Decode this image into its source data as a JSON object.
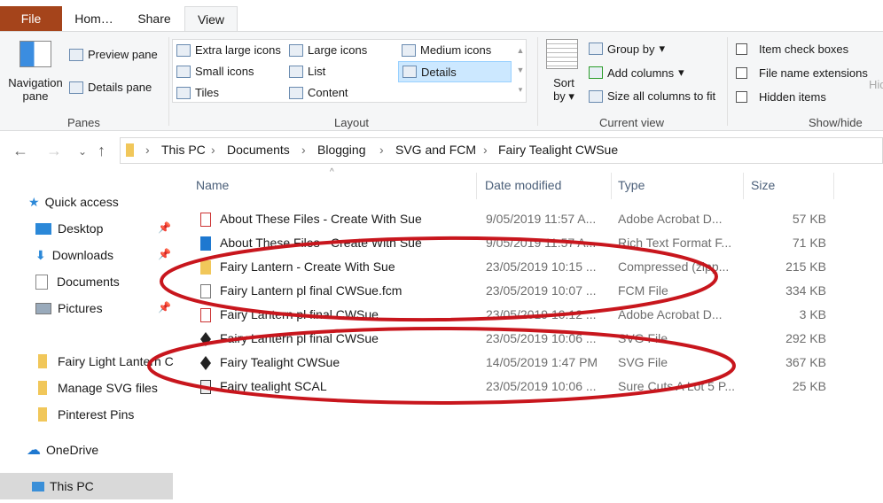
{
  "ribbon_tabs": [
    "File",
    "Hom…",
    "Share",
    "View"
  ],
  "panes": {
    "navigation_pane": "Navigation",
    "navigation_pane2": "pane",
    "preview_pane": "Preview pane",
    "details_pane": "Details pane",
    "label": "Panes"
  },
  "layout": {
    "items": [
      "Extra large icons",
      "Large icons",
      "Medium icons",
      "Small icons",
      "List",
      "Details",
      "Tiles",
      "Content"
    ],
    "selected": "Details",
    "label": "Layout"
  },
  "current_view": {
    "sort": "Sort",
    "sort2": "by",
    "group_by": "Group by",
    "add_columns": "Add columns",
    "size_columns": "Size all columns to fit",
    "label": "Current view"
  },
  "show_hide": {
    "item_check_boxes": "Item check boxes",
    "file_name_extensions": "File name extensions",
    "hidden_items": "Hidden items",
    "label": "Show/hide",
    "hide_cut": "Hid"
  },
  "breadcrumb": [
    "This PC",
    "Documents",
    "Blogging",
    "SVG and FCM",
    "Fairy Tealight CWSue"
  ],
  "sidebar": {
    "quick_access": "Quick access",
    "pinned": [
      "Desktop",
      "Downloads",
      "Documents",
      "Pictures"
    ],
    "folders": [
      "Fairy Light Lantern C",
      "Manage SVG files",
      "Pinterest Pins"
    ],
    "onedrive": "OneDrive",
    "this_pc": "This PC"
  },
  "columns": [
    "Name",
    "Date modified",
    "Type",
    "Size"
  ],
  "files": [
    {
      "name": "About These Files - Create With Sue",
      "date": "9/05/2019 11:57 A...",
      "type": "Adobe Acrobat D...",
      "size": "57 KB",
      "icon": "pdf-icon"
    },
    {
      "name": "About These Files - Create With Sue",
      "date": "9/05/2019 11:57 A...",
      "type": "Rich Text Format F...",
      "size": "71 KB",
      "icon": "rtf-icon"
    },
    {
      "name": "Fairy Lantern - Create With Sue",
      "date": "23/05/2019 10:15 ...",
      "type": "Compressed (zipp...",
      "size": "215 KB",
      "icon": "zip-icon"
    },
    {
      "name": "Fairy Lantern pl final CWSue.fcm",
      "date": "23/05/2019 10:07 ...",
      "type": "FCM File",
      "size": "334 KB",
      "icon": "file-icon"
    },
    {
      "name": "Fairy Lantern pl final CWSue",
      "date": "23/05/2019 10:12 ...",
      "type": "Adobe Acrobat D...",
      "size": "3 KB",
      "icon": "pdf-icon"
    },
    {
      "name": "Fairy Lantern pl final CWSue",
      "date": "23/05/2019 10:06 ...",
      "type": "SVG File",
      "size": "292 KB",
      "icon": "svg-icon"
    },
    {
      "name": "Fairy Tealight CWSue",
      "date": "14/05/2019 1:47 PM",
      "type": "SVG File",
      "size": "367 KB",
      "icon": "svg-icon"
    },
    {
      "name": "Fairy tealight SCAL",
      "date": "23/05/2019 10:06 ...",
      "type": "Sure Cuts A Lot 5 P...",
      "size": "25 KB",
      "icon": "scal-icon"
    }
  ],
  "colors": {
    "file_tab": "#a5441b",
    "annotation": "#c8161d",
    "selected": "#cce8ff"
  }
}
